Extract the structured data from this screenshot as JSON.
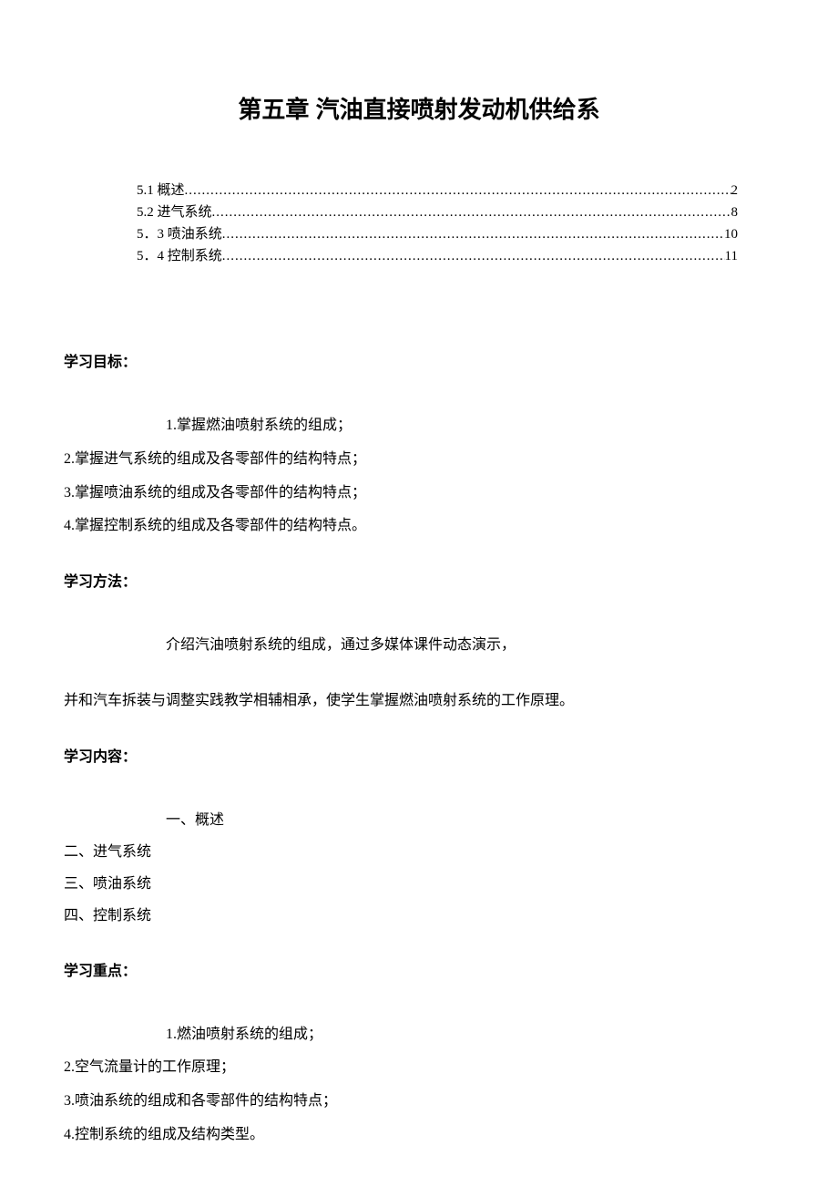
{
  "title": "第五章 汽油直接喷射发动机供给系",
  "toc": [
    {
      "label": "5.1 概述",
      "page": "2"
    },
    {
      "label": "5.2 进气系统",
      "page": "8"
    },
    {
      "label": "5．3  喷油系统",
      "page": "10"
    },
    {
      "label": "5．4  控制系统",
      "page": "11"
    }
  ],
  "sections": {
    "objectives": {
      "heading": "学习目标：",
      "items": [
        "1.掌握燃油喷射系统的组成；",
        "2.掌握进气系统的组成及各零部件的结构特点；",
        "3.掌握喷油系统的组成及各零部件的结构特点；",
        "4.掌握控制系统的组成及各零部件的结构特点。"
      ]
    },
    "methods": {
      "heading": "学习方法：",
      "para1": "介绍汽油喷射系统的组成，通过多媒体课件动态演示，",
      "para2": "并和汽车拆装与调整实践教学相辅相承，使学生掌握燃油喷射系统的工作原理。"
    },
    "content": {
      "heading": "学习内容：",
      "items": [
        "一、概述",
        "二、进气系统",
        "三、喷油系统",
        "四、控制系统"
      ]
    },
    "focus": {
      "heading": "学习重点：",
      "items": [
        "1.燃油喷射系统的组成；",
        "2.空气流量计的工作原理；",
        "3.喷油系统的组成和各零部件的结构特点；",
        "4.控制系统的组成及结构类型。"
      ]
    }
  }
}
